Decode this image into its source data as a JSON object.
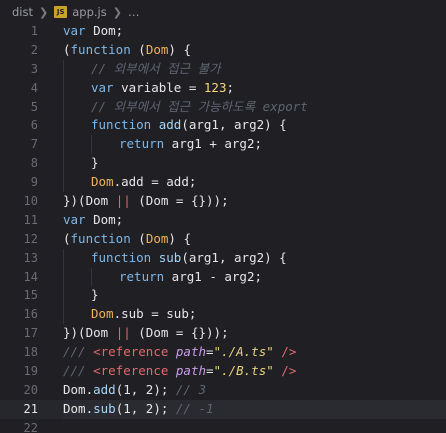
{
  "breadcrumb": {
    "folder": "dist",
    "file": "app.js",
    "more": "…",
    "file_badge": "JS"
  },
  "lines": [
    {
      "n": "1",
      "indent": 0,
      "tokens": [
        [
          "kw",
          "var"
        ],
        [
          "plain",
          " Dom;"
        ]
      ]
    },
    {
      "n": "2",
      "indent": 0,
      "tokens": [
        [
          "punc",
          "("
        ],
        [
          "kw",
          "function"
        ],
        [
          "punc",
          " ("
        ],
        [
          "param",
          "Dom"
        ],
        [
          "punc",
          ") {"
        ]
      ]
    },
    {
      "n": "3",
      "indent": 1,
      "tokens": [
        [
          "cmt",
          "// 외부에서 접근 불가"
        ]
      ]
    },
    {
      "n": "4",
      "indent": 1,
      "tokens": [
        [
          "kw",
          "var"
        ],
        [
          "plain",
          " variable "
        ],
        [
          "op",
          "="
        ],
        [
          "plain",
          " "
        ],
        [
          "num",
          "123"
        ],
        [
          "plain",
          ";"
        ]
      ]
    },
    {
      "n": "5",
      "indent": 1,
      "tokens": [
        [
          "cmt",
          "// 외부에서 접근 가능하도록 export"
        ]
      ]
    },
    {
      "n": "6",
      "indent": 1,
      "tokens": [
        [
          "kw",
          "function"
        ],
        [
          "plain",
          " "
        ],
        [
          "fn",
          "add"
        ],
        [
          "punc",
          "("
        ],
        [
          "plain",
          "arg1, arg2"
        ],
        [
          "punc",
          ") {"
        ]
      ]
    },
    {
      "n": "7",
      "indent": 2,
      "tokens": [
        [
          "kw",
          "return"
        ],
        [
          "plain",
          " arg1 "
        ],
        [
          "op",
          "+"
        ],
        [
          "plain",
          " arg2;"
        ]
      ]
    },
    {
      "n": "8",
      "indent": 1,
      "tokens": [
        [
          "punc",
          "}"
        ]
      ]
    },
    {
      "n": "9",
      "indent": 1,
      "tokens": [
        [
          "obj",
          "Dom"
        ],
        [
          "plain",
          ".add "
        ],
        [
          "op",
          "="
        ],
        [
          "plain",
          " add;"
        ]
      ]
    },
    {
      "n": "10",
      "indent": 0,
      "tokens": [
        [
          "punc",
          "})("
        ],
        [
          "plain",
          "Dom "
        ],
        [
          "or",
          "||"
        ],
        [
          "plain",
          " (Dom "
        ],
        [
          "op",
          "="
        ],
        [
          "plain",
          " {}));"
        ]
      ]
    },
    {
      "n": "11",
      "indent": 0,
      "tokens": [
        [
          "kw",
          "var"
        ],
        [
          "plain",
          " Dom;"
        ]
      ]
    },
    {
      "n": "12",
      "indent": 0,
      "tokens": [
        [
          "punc",
          "("
        ],
        [
          "kw",
          "function"
        ],
        [
          "punc",
          " ("
        ],
        [
          "param",
          "Dom"
        ],
        [
          "punc",
          ") {"
        ]
      ]
    },
    {
      "n": "13",
      "indent": 1,
      "tokens": [
        [
          "kw",
          "function"
        ],
        [
          "plain",
          " "
        ],
        [
          "fn",
          "sub"
        ],
        [
          "punc",
          "("
        ],
        [
          "plain",
          "arg1, arg2"
        ],
        [
          "punc",
          ") {"
        ]
      ]
    },
    {
      "n": "14",
      "indent": 2,
      "tokens": [
        [
          "kw",
          "return"
        ],
        [
          "plain",
          " arg1 "
        ],
        [
          "op",
          "-"
        ],
        [
          "plain",
          " arg2;"
        ]
      ]
    },
    {
      "n": "15",
      "indent": 1,
      "tokens": [
        [
          "punc",
          "}"
        ]
      ]
    },
    {
      "n": "16",
      "indent": 1,
      "tokens": [
        [
          "obj",
          "Dom"
        ],
        [
          "plain",
          ".sub "
        ],
        [
          "op",
          "="
        ],
        [
          "plain",
          " sub;"
        ]
      ]
    },
    {
      "n": "17",
      "indent": 0,
      "tokens": [
        [
          "punc",
          "})("
        ],
        [
          "plain",
          "Dom "
        ],
        [
          "or",
          "||"
        ],
        [
          "plain",
          " (Dom "
        ],
        [
          "op",
          "="
        ],
        [
          "plain",
          " {}));"
        ]
      ]
    },
    {
      "n": "18",
      "indent": 0,
      "tokens": [
        [
          "cmt",
          "/// "
        ],
        [
          "tag",
          "<reference"
        ],
        [
          "plain",
          " "
        ],
        [
          "attr",
          "path"
        ],
        [
          "plain",
          "="
        ],
        [
          "str",
          "\"./A.ts\""
        ],
        [
          "plain",
          " "
        ],
        [
          "tag",
          "/>"
        ]
      ]
    },
    {
      "n": "19",
      "indent": 0,
      "tokens": [
        [
          "cmt",
          "/// "
        ],
        [
          "tag",
          "<reference"
        ],
        [
          "plain",
          " "
        ],
        [
          "attr",
          "path"
        ],
        [
          "plain",
          "="
        ],
        [
          "str",
          "\"./B.ts\""
        ],
        [
          "plain",
          " "
        ],
        [
          "tag",
          "/>"
        ]
      ]
    },
    {
      "n": "20",
      "indent": 0,
      "tokens": [
        [
          "plain",
          "Dom."
        ],
        [
          "fn",
          "add"
        ],
        [
          "plain",
          "(1, 2); "
        ],
        [
          "cmt",
          "// 3"
        ]
      ]
    },
    {
      "n": "21",
      "indent": 0,
      "active": true,
      "tokens": [
        [
          "plain",
          "Dom."
        ],
        [
          "fn",
          "sub"
        ],
        [
          "plain",
          "(1, 2); "
        ],
        [
          "cmt",
          "// -1"
        ]
      ]
    },
    {
      "n": "22",
      "indent": 0,
      "tokens": []
    }
  ]
}
